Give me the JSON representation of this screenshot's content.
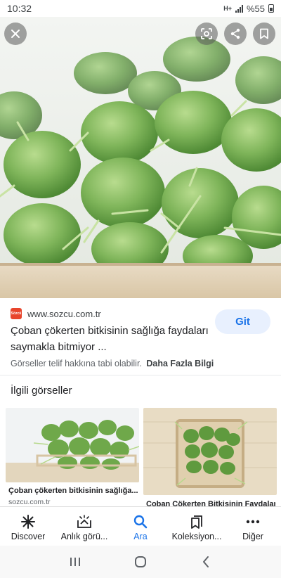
{
  "status_bar": {
    "time": "10:32",
    "network": "H+",
    "battery": "%55"
  },
  "hero": {
    "icons": [
      "close-icon",
      "lens-icon",
      "share-icon",
      "bookmark-icon"
    ]
  },
  "result": {
    "favicon_text": "Sözcü",
    "source_domain": "www.sozcu.com.tr",
    "title": "Çoban çökerten bitkisinin sağlığa faydaları saymakla bitmiyor ...",
    "go_button": "Git",
    "copyright_notice": "Görseller telif hakkına tabi olabilir.",
    "more_info": "Daha Fazla Bilgi"
  },
  "related": {
    "heading": "İlgili görseller",
    "items": [
      {
        "title": "Çoban çökerten bitkisinin sağlığa...",
        "source": "sozcu.com.tr"
      },
      {
        "title": "Coban Cökerten Bitkisinin Faydaları...",
        "source": ""
      }
    ]
  },
  "bottom_nav": {
    "items": [
      {
        "label": "Discover",
        "icon": "asterisk-icon",
        "active": false
      },
      {
        "label": "Anlık görü...",
        "icon": "snapshot-icon",
        "active": false
      },
      {
        "label": "Ara",
        "icon": "search-icon",
        "active": true
      },
      {
        "label": "Koleksiyon...",
        "icon": "collections-icon",
        "active": false
      },
      {
        "label": "Diğer",
        "icon": "more-icon",
        "active": false
      }
    ]
  },
  "colors": {
    "accent": "#1a73e8",
    "go_button_bg": "#e8f0fe",
    "favicon": "#e8452c",
    "plant_green": "#6aa84f"
  }
}
